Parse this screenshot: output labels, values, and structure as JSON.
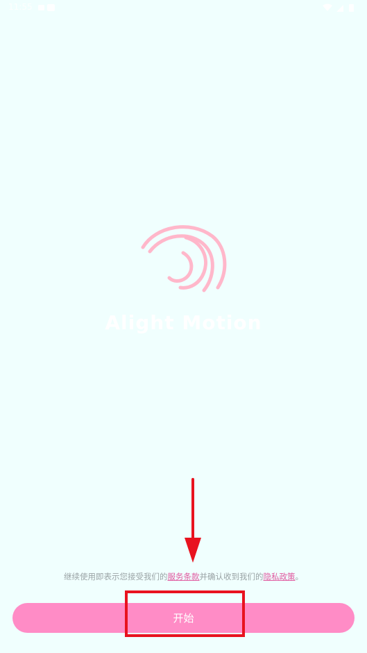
{
  "status_bar": {
    "time": "11:55"
  },
  "app": {
    "name": "Alight Motion"
  },
  "terms": {
    "prefix": "继续使用即表示您接受我们的",
    "service_link": "服务条款",
    "middle": "并确认收到我们的",
    "privacy_link": "隐私政策",
    "suffix": "。"
  },
  "start_button": {
    "label": "开始"
  },
  "colors": {
    "background": "#f0fffe",
    "accent": "#ff8cc6",
    "link": "#e05ba0",
    "annotation": "#e8131f",
    "logo": "#ffb3c7"
  },
  "icons": {
    "logo": "alight-motion-swirl-icon",
    "annotation_arrow": "down-arrow-icon",
    "annotation_box": "highlight-box"
  }
}
